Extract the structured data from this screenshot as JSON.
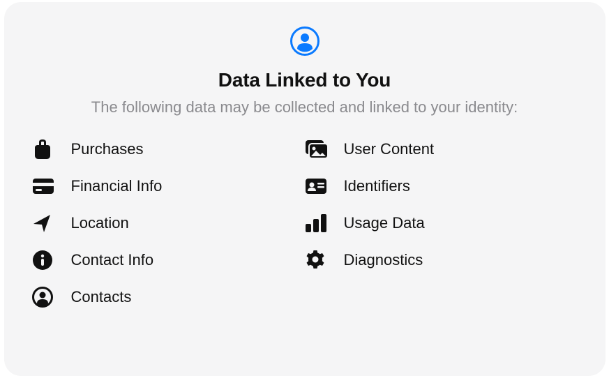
{
  "header": {
    "title": "Data Linked to You",
    "subtitle": "The following data may be collected and linked to your identity:"
  },
  "items": [
    {
      "icon": "shopping-bag",
      "label": "Purchases"
    },
    {
      "icon": "user-content",
      "label": "User Content"
    },
    {
      "icon": "credit-card",
      "label": "Financial Info"
    },
    {
      "icon": "id-card",
      "label": "Identifiers"
    },
    {
      "icon": "location-arrow",
      "label": "Location"
    },
    {
      "icon": "bar-chart",
      "label": "Usage Data"
    },
    {
      "icon": "info-circle",
      "label": "Contact Info"
    },
    {
      "icon": "gear",
      "label": "Diagnostics"
    },
    {
      "icon": "contact-circle",
      "label": "Contacts"
    }
  ],
  "colors": {
    "accent": "#0a7aff"
  }
}
